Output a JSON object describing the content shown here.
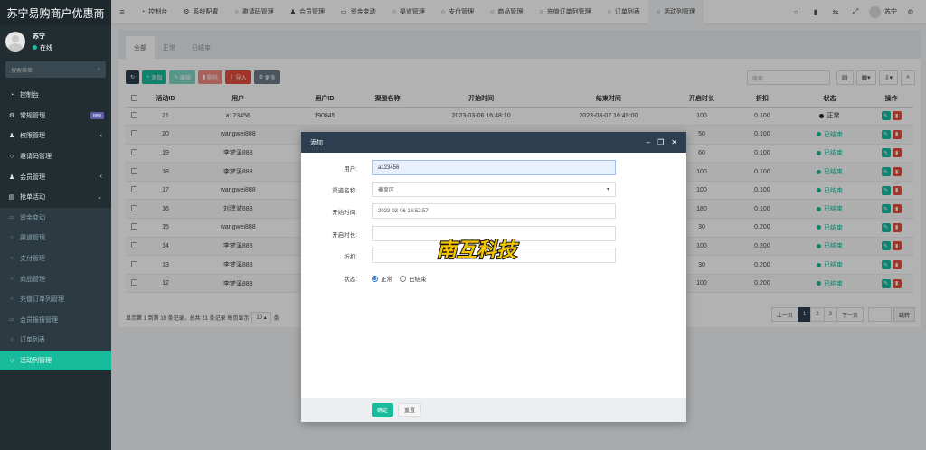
{
  "brand": "苏宁易购商户优惠商",
  "user": {
    "name": "苏宁",
    "status": "在线"
  },
  "sidebar": {
    "search_placeholder": "搜索菜单",
    "items": [
      {
        "label": "控制台",
        "icon": "dashboard-icon",
        "type": "top"
      },
      {
        "label": "常规管理",
        "icon": "cogs-icon",
        "type": "top",
        "badge": "new"
      },
      {
        "label": "权限管理",
        "icon": "group-icon",
        "type": "top",
        "arrow": "‹"
      },
      {
        "label": "邀请码管理",
        "icon": "circle-icon",
        "type": "top"
      },
      {
        "label": "会员管理",
        "icon": "user-icon",
        "type": "top",
        "arrow": "‹"
      },
      {
        "label": "抢单活动",
        "icon": "list-icon",
        "type": "top",
        "arrow": "⌄"
      },
      {
        "label": "资金变动",
        "icon": "money-icon",
        "type": "sub"
      },
      {
        "label": "渠道管理",
        "icon": "circle-icon",
        "type": "sub"
      },
      {
        "label": "支付管理",
        "icon": "circle-icon",
        "type": "sub"
      },
      {
        "label": "商品管理",
        "icon": "circle-icon",
        "type": "sub"
      },
      {
        "label": "充值订单列管理",
        "icon": "circle-icon",
        "type": "sub"
      },
      {
        "label": "会员报报管理",
        "icon": "id-card-icon",
        "type": "sub"
      },
      {
        "label": "订单列表",
        "icon": "circle-icon",
        "type": "sub"
      },
      {
        "label": "活动列管理",
        "icon": "circle-icon",
        "type": "active"
      }
    ]
  },
  "topbar": {
    "tabs": [
      {
        "label": "控制台",
        "icon": "dashboard-icon"
      },
      {
        "label": "系统配置",
        "icon": "gear-icon"
      },
      {
        "label": "邀请码管理",
        "icon": "circle-icon"
      },
      {
        "label": "会员管理",
        "icon": "user-icon"
      },
      {
        "label": "资金变动",
        "icon": "money-icon"
      },
      {
        "label": "渠道管理",
        "icon": "circle-icon"
      },
      {
        "label": "支付管理",
        "icon": "circle-icon"
      },
      {
        "label": "商品管理",
        "icon": "circle-icon"
      },
      {
        "label": "充值订单列管理",
        "icon": "circle-icon"
      },
      {
        "label": "订单列表",
        "icon": "circle-icon"
      },
      {
        "label": "活动列管理",
        "icon": "circle-icon",
        "active": true
      }
    ],
    "username": "苏宁"
  },
  "panel_tabs": [
    "全部",
    "正常",
    "已结束"
  ],
  "toolbar": {
    "add": "添加",
    "edit": "编辑",
    "delete": "删除",
    "import": "导入",
    "more": "更多"
  },
  "search_placeholder": "搜索",
  "table": {
    "headers": [
      "活动ID",
      "用户",
      "用户ID",
      "渠道名称",
      "开始时间",
      "结束时间",
      "开启时长",
      "折扣",
      "状态",
      "操作"
    ],
    "rows": [
      {
        "id": "21",
        "user": "a123456",
        "uid": "190845",
        "channel": "",
        "start": "2023-03-06 16:48:10",
        "end": "2023-03-07 16:49:00",
        "dur": "100",
        "disc": "0.100",
        "status": "正常",
        "on": true
      },
      {
        "id": "20",
        "user": "wangwei888",
        "uid": "",
        "channel": "",
        "start": "",
        "end": "",
        "dur": "50",
        "disc": "0.100",
        "status": "已结束",
        "on": false
      },
      {
        "id": "19",
        "user": "李梦溪888",
        "uid": "",
        "channel": "",
        "start": "",
        "end": "",
        "dur": "60",
        "disc": "0.100",
        "status": "已结束",
        "on": false
      },
      {
        "id": "18",
        "user": "李梦溪888",
        "uid": "",
        "channel": "",
        "start": "",
        "end": "",
        "dur": "100",
        "disc": "0.100",
        "status": "已结束",
        "on": false
      },
      {
        "id": "17",
        "user": "wangwei888",
        "uid": "",
        "channel": "",
        "start": "",
        "end": "",
        "dur": "100",
        "disc": "0.100",
        "status": "已结束",
        "on": false
      },
      {
        "id": "16",
        "user": "刘建波888",
        "uid": "",
        "channel": "",
        "start": "",
        "end": "",
        "dur": "180",
        "disc": "0.100",
        "status": "已结束",
        "on": false
      },
      {
        "id": "15",
        "user": "wangwei888",
        "uid": "",
        "channel": "",
        "start": "",
        "end": "",
        "dur": "30",
        "disc": "0.200",
        "status": "已结束",
        "on": false
      },
      {
        "id": "14",
        "user": "李梦溪888",
        "uid": "",
        "channel": "",
        "start": "",
        "end": "",
        "dur": "100",
        "disc": "0.200",
        "status": "已结束",
        "on": false
      },
      {
        "id": "13",
        "user": "李梦溪888",
        "uid": "",
        "channel": "",
        "start": "",
        "end": "",
        "dur": "30",
        "disc": "0.200",
        "status": "已结束",
        "on": false
      },
      {
        "id": "12",
        "user": "李梦溪888",
        "uid": "",
        "channel": "",
        "start": "",
        "end": "",
        "dur": "100",
        "disc": "0.200",
        "status": "已结束",
        "on": false
      }
    ]
  },
  "footer": {
    "text": "显示第 1 到第 10 条记录，总共 21 条记录 每页显示",
    "per_page": "10 ▴",
    "tail": "条"
  },
  "pager": {
    "prev": "上一页",
    "pages": [
      "1",
      "2",
      "3"
    ],
    "next": "下一页",
    "jump": "跳转"
  },
  "modal": {
    "title": "添加",
    "fields": [
      {
        "label": "用户:",
        "value": "a123456"
      },
      {
        "label": "渠道名称:",
        "value": "秦皇区"
      },
      {
        "label": "开始时间:",
        "value": "2023-03-06 16:52:57"
      },
      {
        "label": "开启时长:",
        "value": ""
      },
      {
        "label": "折扣:",
        "value": ""
      }
    ],
    "status_label": "状态:",
    "status_opts": [
      "正常",
      "已结束"
    ],
    "ok": "确定",
    "reset": "重置"
  },
  "watermark": "南互科技"
}
